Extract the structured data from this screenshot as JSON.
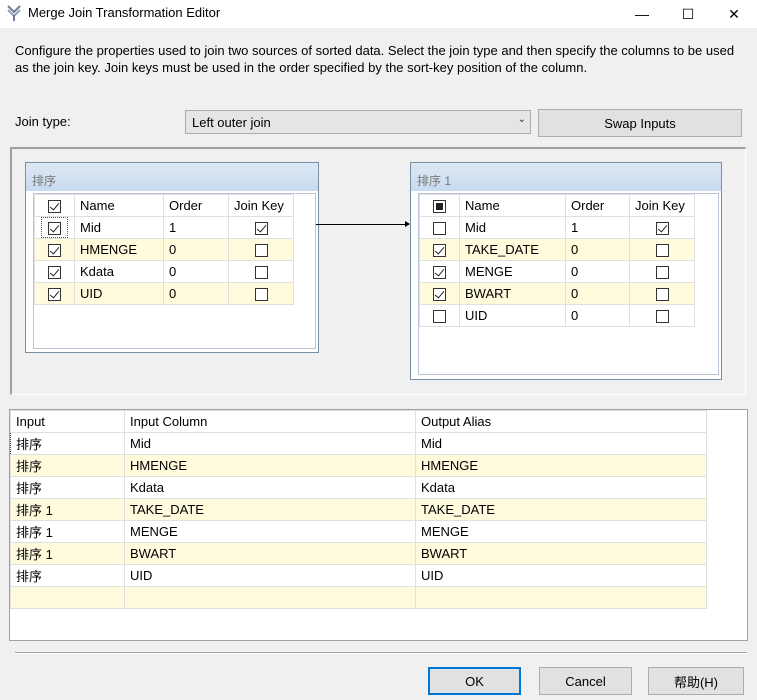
{
  "window": {
    "title": "Merge Join Transformation Editor",
    "minimize": "—",
    "maximize": "☐",
    "close": "✕"
  },
  "description": "Configure the properties used to join two sources of sorted data. Select the join type and then specify the columns to be used as the join key. Join keys must be used in the order specified by the sort-key position of the column.",
  "join_type": {
    "label": "Join type:",
    "value": "Left outer join",
    "swap_label": "Swap Inputs"
  },
  "left_source": {
    "title": "排序",
    "headers": [
      "Name",
      "Order",
      "Join Key"
    ],
    "header_checked": true,
    "rows": [
      {
        "checked": true,
        "name": "Mid",
        "order": "1",
        "join_key": true
      },
      {
        "checked": true,
        "name": "HMENGE",
        "order": "0",
        "join_key": false
      },
      {
        "checked": true,
        "name": "Kdata",
        "order": "0",
        "join_key": false
      },
      {
        "checked": true,
        "name": "UID",
        "order": "0",
        "join_key": false
      }
    ]
  },
  "right_source": {
    "title": "排序 1",
    "headers": [
      "Name",
      "Order",
      "Join Key"
    ],
    "header_state": "indeterminate",
    "rows": [
      {
        "checked": false,
        "name": "Mid",
        "order": "1",
        "join_key": true
      },
      {
        "checked": true,
        "name": "TAKE_DATE",
        "order": "0",
        "join_key": false
      },
      {
        "checked": true,
        "name": "MENGE",
        "order": "0",
        "join_key": false
      },
      {
        "checked": true,
        "name": "BWART",
        "order": "0",
        "join_key": false
      },
      {
        "checked": false,
        "name": "UID",
        "order": "0",
        "join_key": false
      }
    ]
  },
  "output": {
    "headers": [
      "Input",
      "Input Column",
      "Output Alias"
    ],
    "rows": [
      {
        "input": "排序",
        "column": "Mid",
        "alias": "Mid"
      },
      {
        "input": "排序",
        "column": "HMENGE",
        "alias": "HMENGE"
      },
      {
        "input": "排序",
        "column": "Kdata",
        "alias": "Kdata"
      },
      {
        "input": "排序 1",
        "column": "TAKE_DATE",
        "alias": "TAKE_DATE"
      },
      {
        "input": "排序 1",
        "column": "MENGE",
        "alias": "MENGE"
      },
      {
        "input": "排序 1",
        "column": "BWART",
        "alias": "BWART"
      },
      {
        "input": "排序",
        "column": "UID",
        "alias": "UID"
      }
    ]
  },
  "buttons": {
    "ok": "OK",
    "cancel": "Cancel",
    "help": "帮助(H)"
  },
  "colors": {
    "alt_row": "#fffbdc",
    "accent": "#0078d7"
  }
}
